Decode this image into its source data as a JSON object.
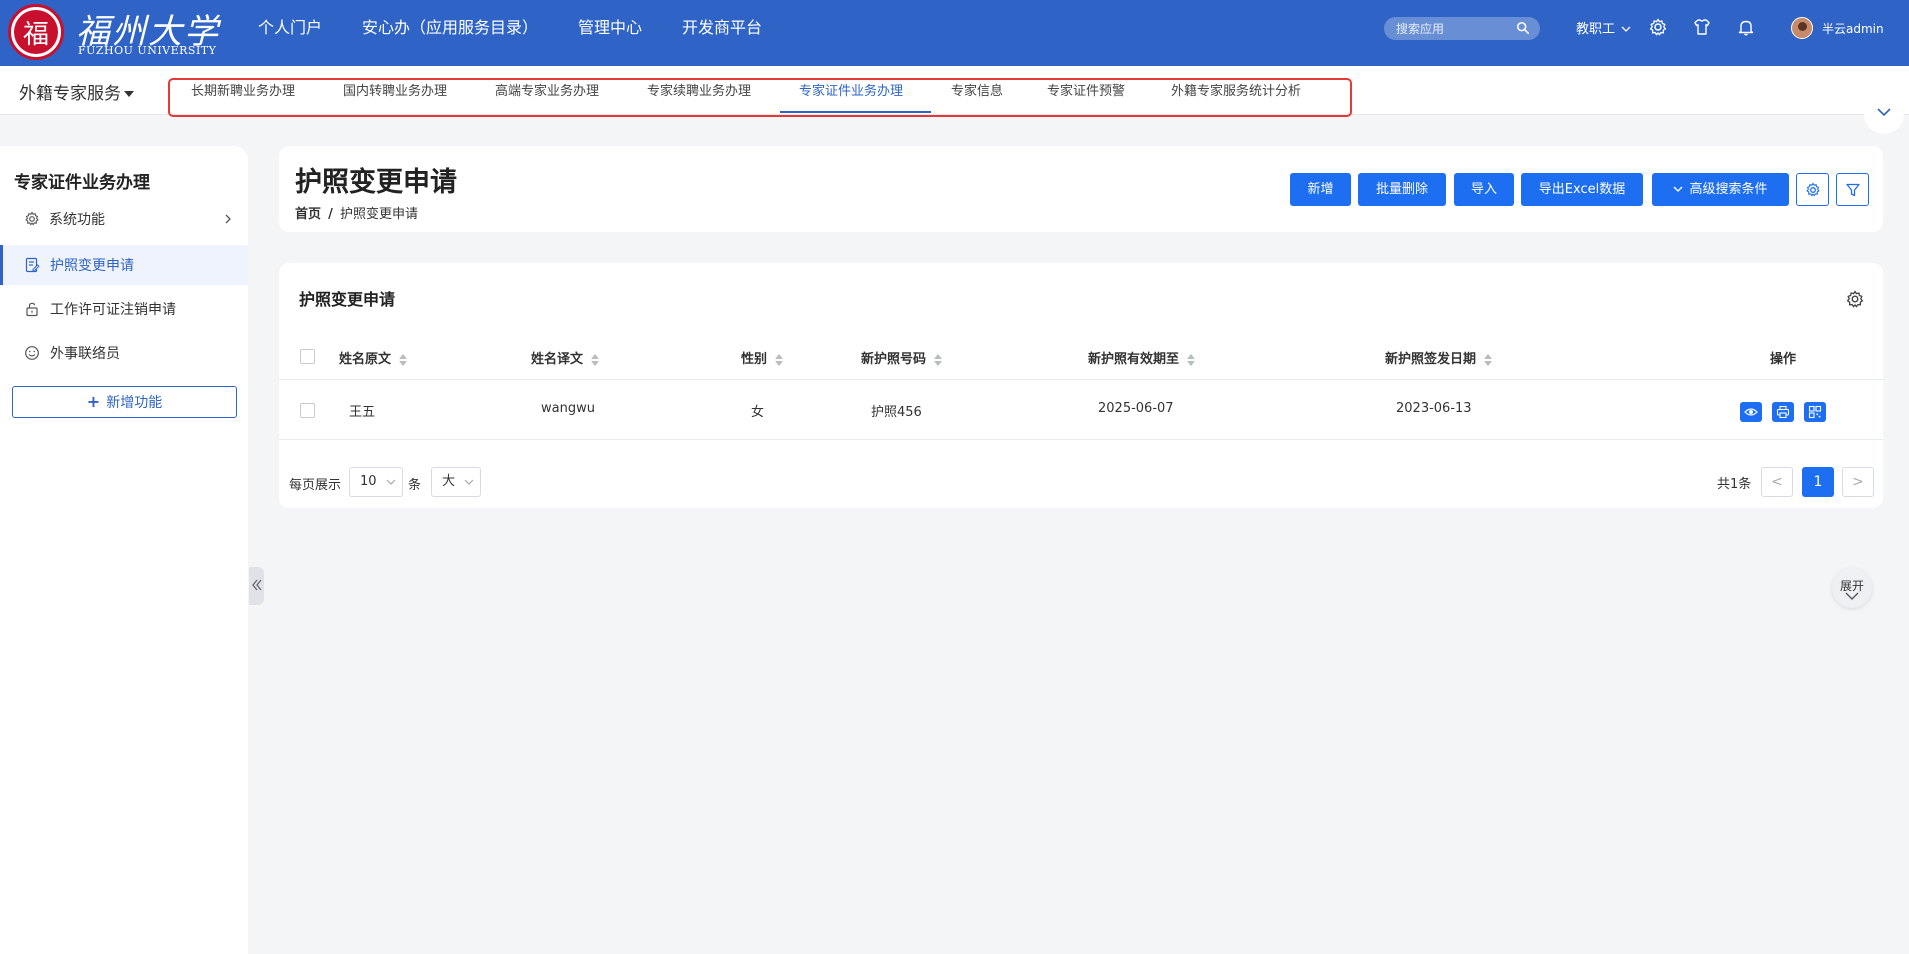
{
  "brand": {
    "seal_char": "福",
    "name_cn": "福州大学",
    "name_en": "FUZHOU UNIVERSITY"
  },
  "top_nav": [
    "个人门户",
    "安心办（应用服务目录）",
    "管理中心",
    "开发商平台"
  ],
  "search": {
    "placeholder": "搜索应用"
  },
  "user": {
    "role": "教职工",
    "name": "半云admin"
  },
  "module": {
    "title": "外籍专家服务"
  },
  "tabs": [
    {
      "label": "长期新聘业务办理",
      "active": false
    },
    {
      "label": "国内转聘业务办理",
      "active": false
    },
    {
      "label": "高端专家业务办理",
      "active": false
    },
    {
      "label": "专家续聘业务办理",
      "active": false
    },
    {
      "label": "专家证件业务办理",
      "active": true
    },
    {
      "label": "专家信息",
      "active": false
    },
    {
      "label": "专家证件预警",
      "active": false
    },
    {
      "label": "外籍专家服务统计分析",
      "active": false
    }
  ],
  "sidebar": {
    "title": "专家证件业务办理",
    "items": [
      {
        "label": "系统功能",
        "icon": "gear-icon",
        "active": false
      },
      {
        "label": "护照变更申请",
        "icon": "form-icon",
        "active": true
      },
      {
        "label": "工作许可证注销申请",
        "icon": "unlock-icon",
        "active": false
      },
      {
        "label": "外事联络员",
        "icon": "smile-icon",
        "active": false
      }
    ],
    "add_label": "新增功能"
  },
  "header": {
    "title": "护照变更申请",
    "breadcrumb_home": "首页",
    "breadcrumb_sep": "/",
    "breadcrumb_current": "护照变更申请",
    "buttons": {
      "add": "新增",
      "batch_delete": "批量删除",
      "import": "导入",
      "export": "导出Excel数据",
      "advanced_search": "高级搜索条件"
    }
  },
  "table": {
    "title": "护照变更申请",
    "columns": [
      "姓名原文",
      "姓名译文",
      "性别",
      "新护照号码",
      "新护照有效期至",
      "新护照签发日期",
      "操作"
    ],
    "rows": [
      [
        "王五",
        "wangwu",
        "女",
        "护照456",
        "2025-06-07",
        "2023-06-13"
      ]
    ]
  },
  "pager": {
    "per_page_label": "每页展示",
    "per_page_value": "10",
    "unit": "条",
    "size_value": "大",
    "total": "共1条",
    "prev": "<",
    "current": "1",
    "next": ">"
  },
  "float_expand": {
    "label": "展开"
  },
  "colors": {
    "primary": "#1d6ef0",
    "topbar": "#2f64c6",
    "highlight_frame": "#e53935"
  }
}
